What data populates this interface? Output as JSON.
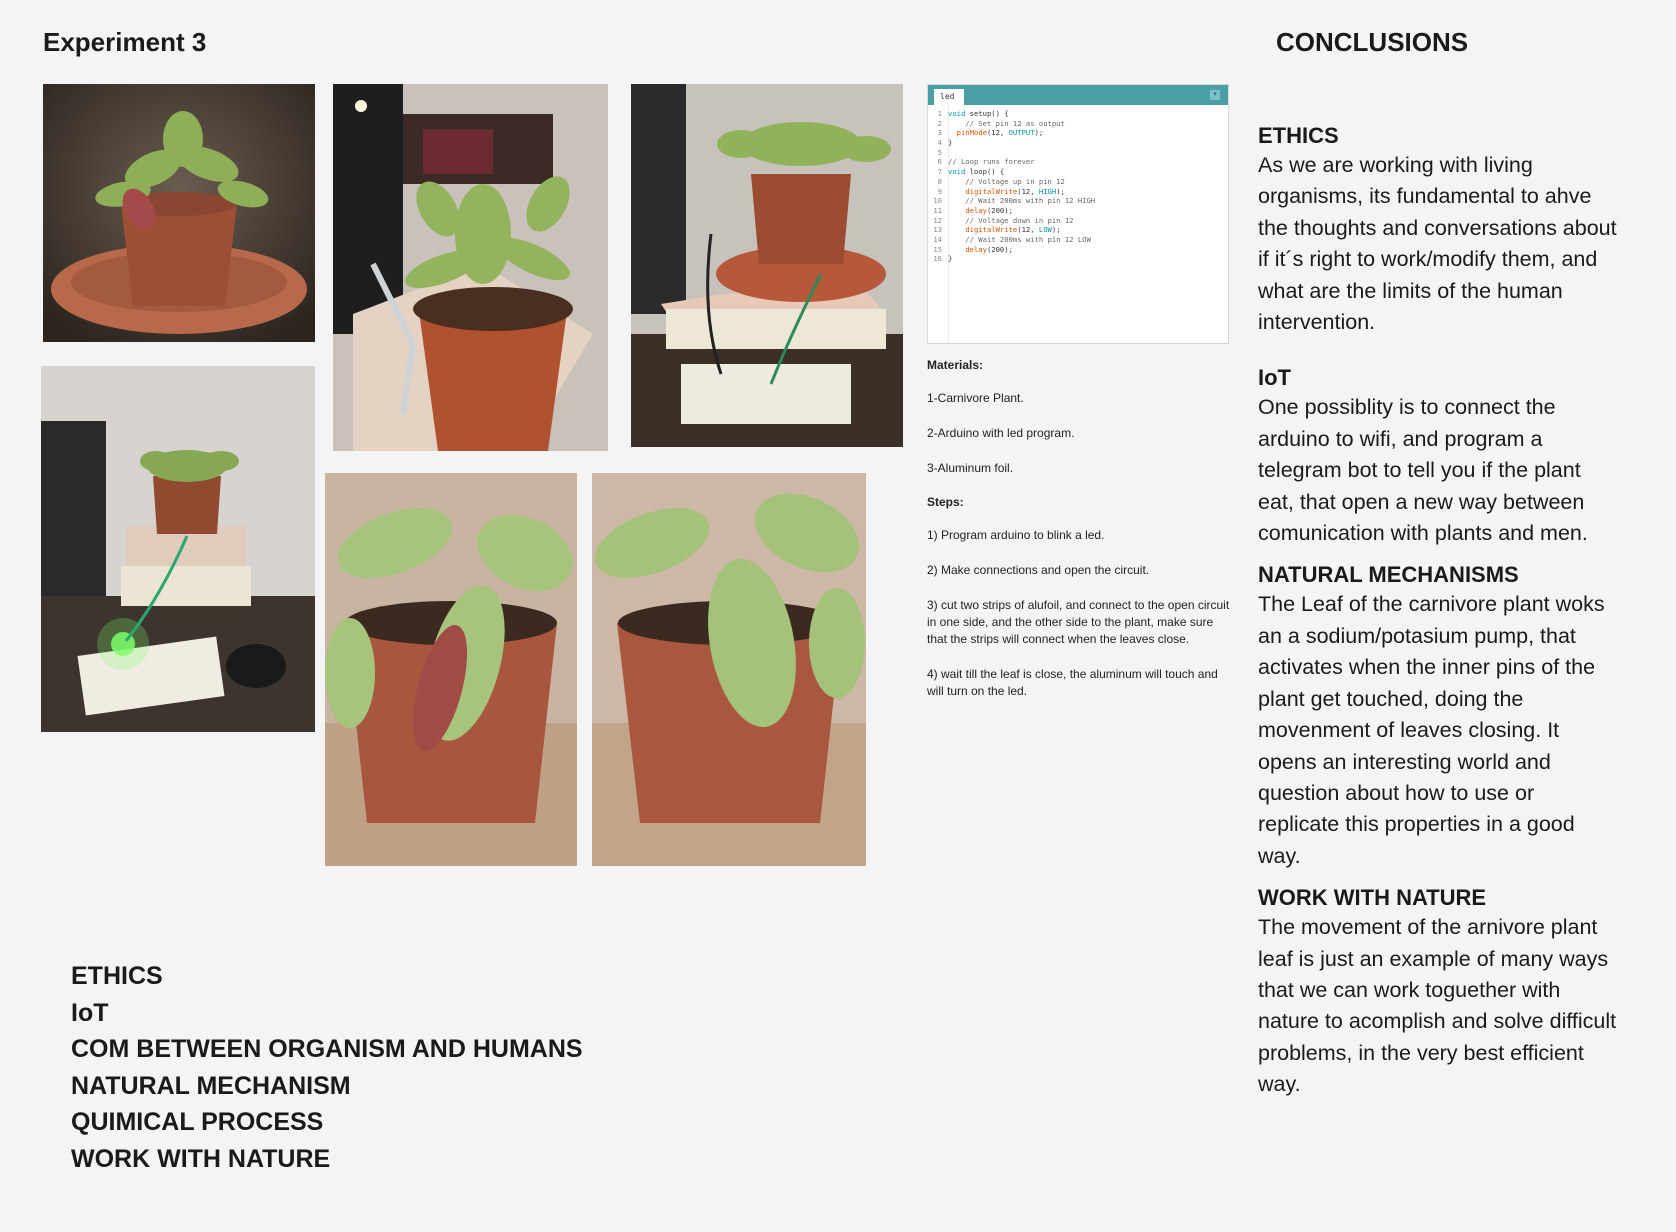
{
  "page": {
    "title": "Experiment 3",
    "conclusions_title": "CONCLUSIONS"
  },
  "editor": {
    "tab": "led",
    "lines": [
      "void setup() {",
      "    // Set pin 12 as output",
      "  pinMode(12, OUTPUT);",
      "}",
      "",
      "// Loop runs forever",
      "void loop() {",
      "    // Voltage up in pin 12",
      "    digitalWrite(12, HIGH);",
      "    // Wait 200ms with pin 12 HIGH",
      "    delay(200);",
      "    // Voltage down in pin 12",
      "    digitalWrite(12, LOW);",
      "    // Wait 200ms with pin 12 LOW",
      "    delay(200);",
      "}"
    ]
  },
  "materials": {
    "heading": "Materials:",
    "items": [
      "1-Carnivore Plant.",
      "2-Arduino with led program.",
      "3-Aluminum foil."
    ],
    "steps_heading": "Steps:",
    "steps": [
      "1) Program arduino to blink a led.",
      "2) Make connections and open the circuit.",
      "3) cut two strips of alufoil, and connect to the open circuit in one side, and the other side to the plant, make sure that the strips will connect when the leaves close.",
      "4) wait till the leaf is close, the aluminum will touch and will turn on the led."
    ]
  },
  "keywords": [
    "ETHICS",
    "IoT",
    "COM BETWEEN ORGANISM AND HUMANS",
    "NATURAL MECHANISM",
    "QUIMICAL PROCESS",
    "WORK WITH NATURE"
  ],
  "conclusions": [
    {
      "heading": "ETHICS",
      "body": "As we are working with living organisms, its fundamental to ahve the thoughts and conversations about if it´s right to work/modify them, and what are the limits of the human intervention."
    },
    {
      "heading": "IoT",
      "body": "One possiblity is to connect the arduino to wifi, and program a telegram bot to tell you if the plant eat, that open a new way between comunication with plants and men."
    },
    {
      "heading": "NATURAL MECHANISMS",
      "body": "The Leaf of the carnivore plant woks an a sodium/potasium pump, that activates when the inner pins of the plant get touched, doing the movenment of leaves closing. It opens an interesting world and question about how to use or replicate this properties in a good way."
    },
    {
      "heading": "WORK WITH NATURE",
      "body": "The movement of the arnivore plant leaf is just an example of many ways that we can work toguether with nature to acomplish and solve difficult problems, in the very best efficient way."
    }
  ],
  "photos": [
    {
      "subject": "venus-flytrap-on-saucer"
    },
    {
      "subject": "flytrap-with-foil-strips"
    },
    {
      "subject": "flytrap-on-books-with-breadboard"
    },
    {
      "subject": "flytrap-green-led-lit"
    },
    {
      "subject": "flytrap-leaf-closeup-left"
    },
    {
      "subject": "flytrap-leaf-closeup-right"
    }
  ]
}
